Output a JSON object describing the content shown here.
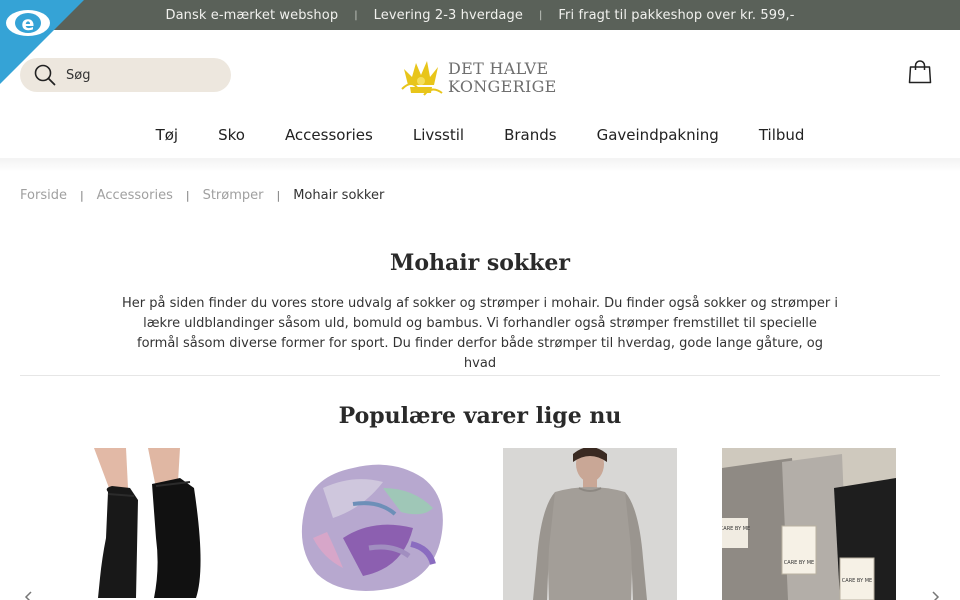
{
  "topbar": {
    "items": [
      "Dansk e-mærket webshop",
      "Levering 2-3 hverdage",
      "Fri fragt til pakkeshop over kr. 599,-"
    ],
    "separator": "|",
    "bg_color": "#5a6159"
  },
  "badge": {
    "icon": "e-maerket-icon",
    "color": "#35a3d6"
  },
  "search": {
    "placeholder": "Søg",
    "icon": "search-icon"
  },
  "logo": {
    "line1": "DET HALVE",
    "line2": "KONGERIGE",
    "icon": "crown-logo-icon",
    "accent": "#e8c51a"
  },
  "cart": {
    "icon": "shopping-bag-icon"
  },
  "nav": {
    "items": [
      "Tøj",
      "Sko",
      "Accessories",
      "Livsstil",
      "Brands",
      "Gaveindpakning",
      "Tilbud"
    ]
  },
  "breadcrumb": {
    "items": [
      "Forside",
      "Accessories",
      "Strømper"
    ],
    "current": "Mohair sokker",
    "separator": "|"
  },
  "page": {
    "title": "Mohair sokker",
    "intro_lines": [
      "Her på siden finder du vores store udvalg af sokker og strømper i mohair. Du finder også sokker og strømper i",
      "lækre uldblandinger såsom uld, bomuld og bambus. Vi forhandler også strømper fremstillet til specielle",
      "formål såsom diverse former for sport. Du finder derfor både strømper til hverdag, gode lange gåture, og hvad"
    ]
  },
  "popular": {
    "title": "Populære varer lige nu",
    "products": [
      {
        "image": "black-socks-on-feet"
      },
      {
        "image": "colorful-scarf"
      },
      {
        "image": "grey-long-sleeve-top"
      },
      {
        "image": "care-by-me-socks"
      }
    ],
    "prev_icon": "chevron-left-icon",
    "next_icon": "chevron-right-icon"
  },
  "care_label": "CARE BY ME"
}
